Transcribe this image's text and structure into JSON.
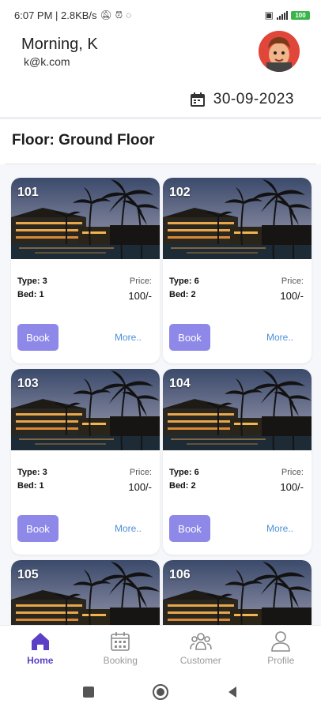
{
  "status_bar": {
    "time_info": "6:07 PM | 2.8KB/s",
    "battery": "100"
  },
  "header": {
    "greeting": "Morning, K",
    "email": "k@k.com",
    "date": "30-09-2023"
  },
  "floor": {
    "title": "Floor: Ground Floor"
  },
  "rooms": [
    {
      "number": "101",
      "type": "Type: 3",
      "bed": "Bed: 1",
      "price_label": "Price:",
      "price": "100/-",
      "book_label": "Book",
      "more_label": "More.."
    },
    {
      "number": "102",
      "type": "Type: 6",
      "bed": "Bed: 2",
      "price_label": "Price:",
      "price": "100/-",
      "book_label": "Book",
      "more_label": "More.."
    },
    {
      "number": "103",
      "type": "Type: 3",
      "bed": "Bed: 1",
      "price_label": "Price:",
      "price": "100/-",
      "book_label": "Book",
      "more_label": "More.."
    },
    {
      "number": "104",
      "type": "Type: 6",
      "bed": "Bed: 2",
      "price_label": "Price:",
      "price": "100/-",
      "book_label": "Book",
      "more_label": "More.."
    },
    {
      "number": "105"
    },
    {
      "number": "106"
    }
  ],
  "bottom_nav": [
    {
      "label": "Home",
      "icon": "home-icon",
      "active": true
    },
    {
      "label": "Booking",
      "icon": "calendar-icon",
      "active": false
    },
    {
      "label": "Customer",
      "icon": "users-icon",
      "active": false
    },
    {
      "label": "Profile",
      "icon": "person-icon",
      "active": false
    }
  ],
  "colors": {
    "accent": "#5b3fc4",
    "book_button": "#8e88e8",
    "more_link": "#4a90d9"
  }
}
